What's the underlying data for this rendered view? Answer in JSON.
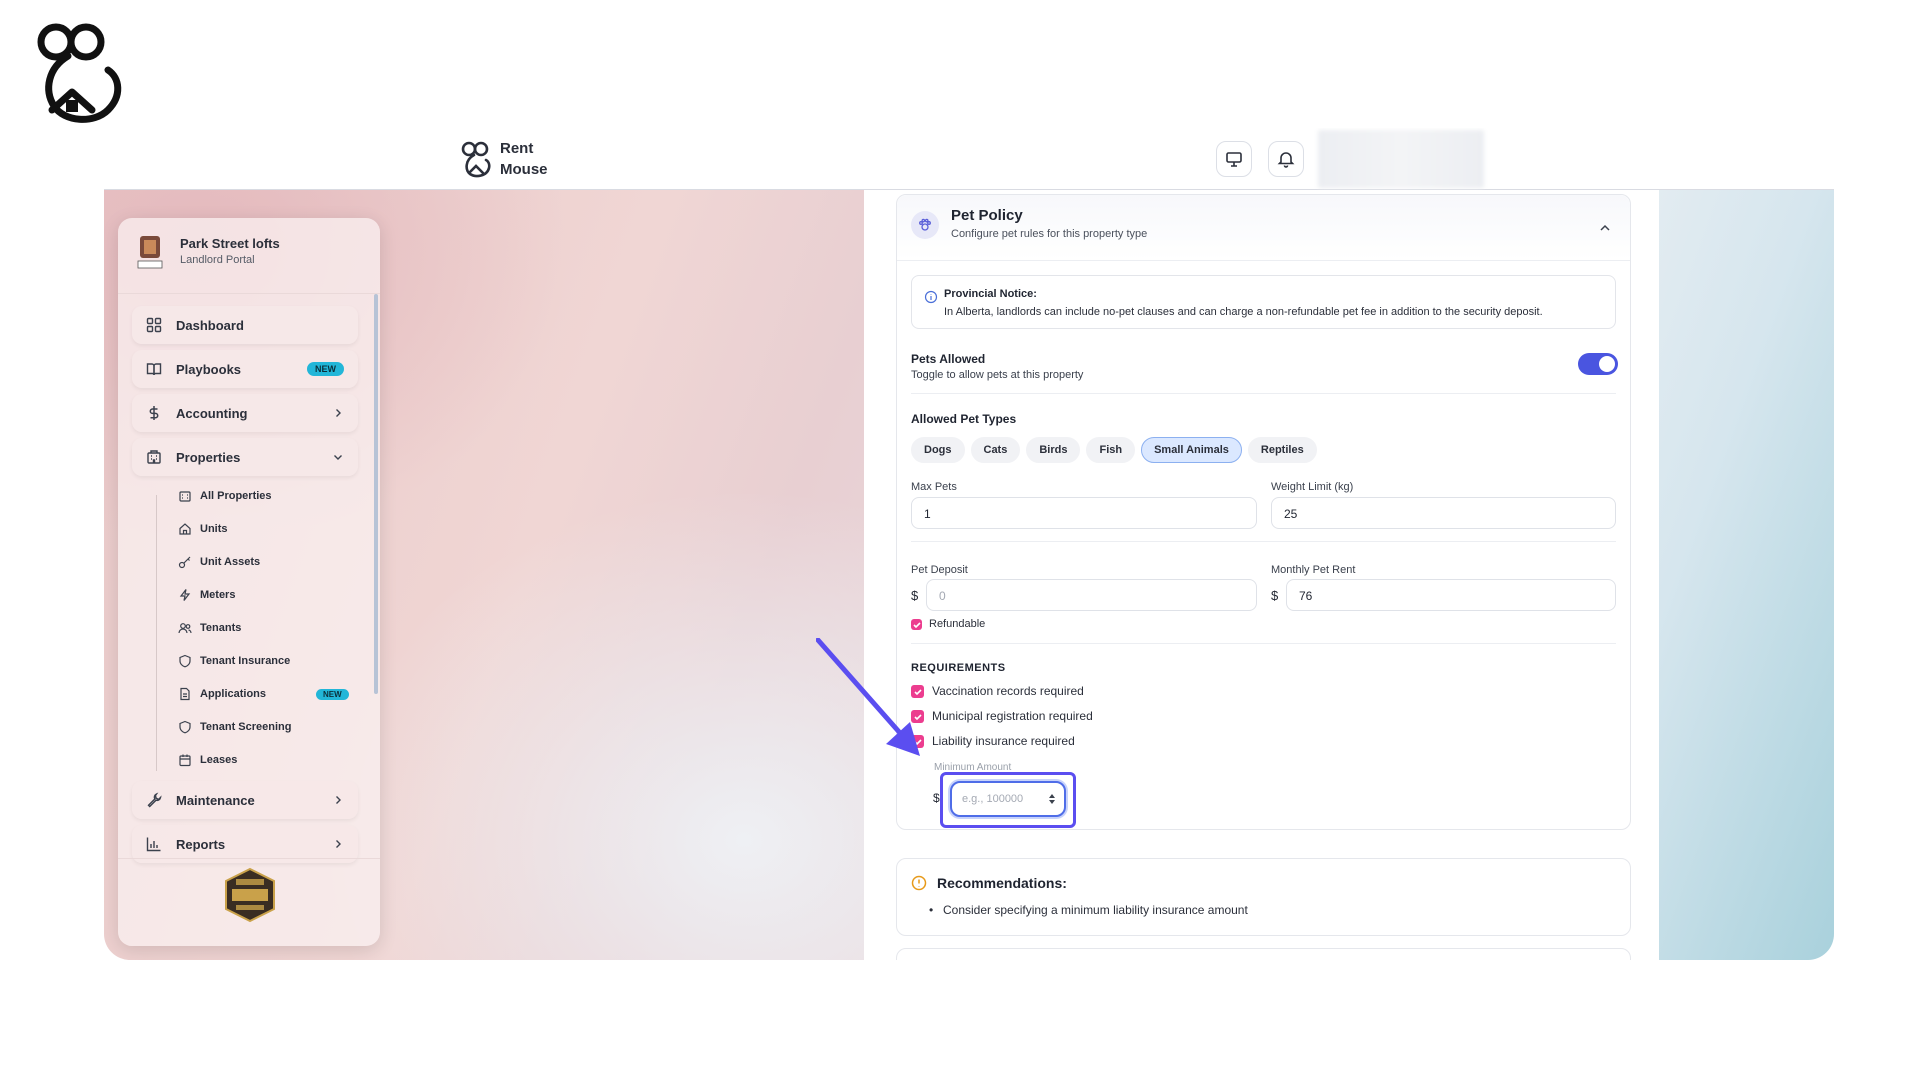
{
  "app": {
    "name": "Rent Mouse"
  },
  "sidebar": {
    "property_name": "Park Street lofts",
    "portal": "Landlord Portal",
    "items": [
      {
        "label": "Dashboard"
      },
      {
        "label": "Playbooks",
        "badge": "NEW"
      },
      {
        "label": "Accounting"
      },
      {
        "label": "Properties"
      },
      {
        "label": "Maintenance"
      },
      {
        "label": "Reports"
      }
    ],
    "sub_items": [
      {
        "label": "All Properties"
      },
      {
        "label": "Units"
      },
      {
        "label": "Unit Assets"
      },
      {
        "label": "Meters"
      },
      {
        "label": "Tenants"
      },
      {
        "label": "Tenant Insurance"
      },
      {
        "label": "Applications",
        "badge": "NEW"
      },
      {
        "label": "Tenant Screening"
      },
      {
        "label": "Leases"
      }
    ]
  },
  "pet_policy": {
    "title": "Pet Policy",
    "subtitle": "Configure pet rules for this property type",
    "notice_title": "Provincial Notice:",
    "notice_text": "In Alberta, landlords can include no-pet clauses and can charge a non-refundable pet fee in addition to the security deposit.",
    "pets_allowed_label": "Pets Allowed",
    "pets_allowed_desc": "Toggle to allow pets at this property",
    "pets_allowed": true,
    "allowed_types_label": "Allowed Pet Types",
    "pet_types": [
      {
        "label": "Dogs",
        "selected": false
      },
      {
        "label": "Cats",
        "selected": false
      },
      {
        "label": "Birds",
        "selected": false
      },
      {
        "label": "Fish",
        "selected": false
      },
      {
        "label": "Small Animals",
        "selected": true
      },
      {
        "label": "Reptiles",
        "selected": false
      }
    ],
    "max_pets_label": "Max Pets",
    "max_pets_value": "1",
    "weight_limit_label": "Weight Limit (kg)",
    "weight_limit_value": "25",
    "pet_deposit_label": "Pet Deposit",
    "pet_deposit_placeholder": "0",
    "monthly_rent_label": "Monthly Pet Rent",
    "monthly_rent_value": "76",
    "currency_symbol": "$",
    "refundable_label": "Refundable",
    "requirements_heading": "REQUIREMENTS",
    "requirements": [
      {
        "label": "Vaccination records required",
        "checked": true
      },
      {
        "label": "Municipal registration required",
        "checked": true
      },
      {
        "label": "Liability insurance required",
        "checked": true
      }
    ],
    "minimum_amount_label": "Minimum Amount",
    "minimum_amount_placeholder": "e.g., 100000"
  },
  "recommendations": {
    "title": "Recommendations:",
    "items": [
      "Consider specifying a minimum liability insurance amount"
    ]
  },
  "colors": {
    "accent": "#4a55e0",
    "checkbox": "#ec3d8f",
    "badge": "#22b6d8",
    "arrow": "#5b4ef0"
  }
}
